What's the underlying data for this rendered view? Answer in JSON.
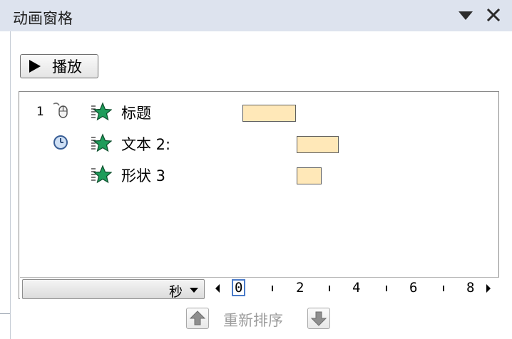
{
  "pane": {
    "title": "动画窗格"
  },
  "toolbar": {
    "play_label": "播放"
  },
  "animations": [
    {
      "number": "1",
      "trigger": "mouse-click-icon",
      "effect": "entrance-star-icon",
      "label": "标题"
    },
    {
      "number": "",
      "trigger": "clock-icon",
      "effect": "entrance-star-icon",
      "label": "文本 2:"
    },
    {
      "number": "",
      "trigger": "",
      "effect": "entrance-star-icon",
      "label": "形状 3"
    }
  ],
  "timeline": {
    "unit_label": "秒",
    "ticks": [
      "0",
      "2",
      "4",
      "6",
      "8"
    ],
    "selected_tick": "0"
  },
  "reorder": {
    "label": "重新排序"
  },
  "colors": {
    "titlebar": "#dde3ee",
    "bar_fill": "#ffe8b8",
    "effect_green": "#1e9c5a",
    "selected_tick_border": "#4a7bc9"
  }
}
